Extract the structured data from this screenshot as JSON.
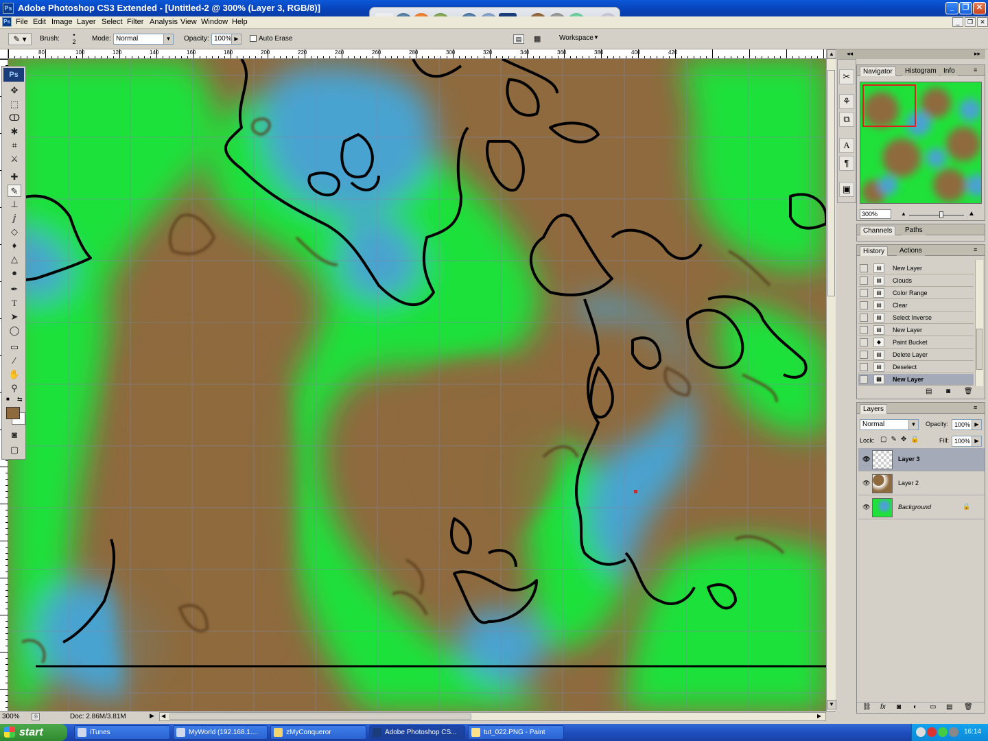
{
  "window": {
    "title": "Adobe Photoshop CS3 Extended - [Untitled-2 @ 300% (Layer 3, RGB/8)]"
  },
  "menu": [
    "File",
    "Edit",
    "Image",
    "Layer",
    "Select",
    "Filter",
    "Analysis",
    "View",
    "Window",
    "Help"
  ],
  "options": {
    "brush_label": "Brush:",
    "brush_size": "2",
    "mode_label": "Mode:",
    "mode_value": "Normal",
    "opacity_label": "Opacity:",
    "opacity_value": "100%",
    "auto_erase": "Auto Erase",
    "workspace": "Workspace"
  },
  "ruler_top": [
    "80",
    "100",
    "120",
    "140",
    "160",
    "180",
    "200",
    "220",
    "240",
    "260",
    "280",
    "300",
    "320",
    "340",
    "360",
    "380",
    "400",
    "420"
  ],
  "status": {
    "zoom": "300%",
    "doc": "Doc: 2.86M/3.81M"
  },
  "navigator": {
    "tabs": [
      "Navigator",
      "Histogram",
      "Info"
    ],
    "zoom": "300%"
  },
  "channels": {
    "tabs": [
      "Channels",
      "Paths"
    ]
  },
  "history": {
    "tabs": [
      "History",
      "Actions"
    ],
    "items": [
      "New Layer",
      "Clouds",
      "Color Range",
      "Clear",
      "Select Inverse",
      "New Layer",
      "Paint Bucket",
      "Delete Layer",
      "Deselect",
      "New Layer"
    ],
    "selected_index": 9
  },
  "layers": {
    "tab": "Layers",
    "blend": "Normal",
    "opacity_label": "Opacity:",
    "opacity": "100%",
    "lock_label": "Lock:",
    "fill_label": "Fill:",
    "fill": "100%",
    "items": [
      "Layer 3",
      "Layer 2",
      "Background"
    ]
  },
  "taskbar": {
    "start": "start",
    "tasks": [
      "iTunes",
      "MyWorld (192.168.1....",
      "zMyConqueror",
      "Adobe Photoshop CS...",
      "tut_022.PNG - Paint"
    ],
    "clock": "16:14"
  },
  "colors": {
    "brown": "#8e6a3e",
    "green": "#1fe13a",
    "blue": "#4aa3d0",
    "outline": "#000000"
  }
}
